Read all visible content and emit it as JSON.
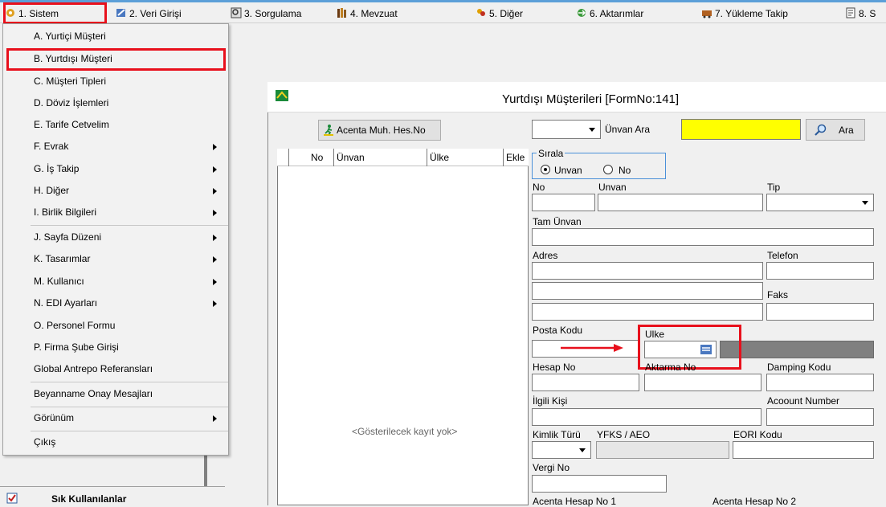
{
  "menubar": {
    "items": [
      {
        "label": "1. Sistem"
      },
      {
        "label": "2. Veri Girişi"
      },
      {
        "label": "3. Sorgulama"
      },
      {
        "label": "4. Mevzuat"
      },
      {
        "label": "5. Diğer"
      },
      {
        "label": "6. Aktarımlar"
      },
      {
        "label": "7. Yükleme Takip"
      },
      {
        "label": "8. S"
      }
    ]
  },
  "dropdown": {
    "items": [
      {
        "label": "A. Yurtiçi Müşteri"
      },
      {
        "label": "B. Yurtdışı Müşteri"
      },
      {
        "label": "C. Müşteri Tipleri"
      },
      {
        "label": "D. Döviz İşlemleri"
      },
      {
        "label": "E. Tarife Cetvelim"
      },
      {
        "label": "F. Evrak"
      },
      {
        "label": "G. İş Takip"
      },
      {
        "label": "H. Diğer"
      },
      {
        "label": "I. Birlik Bilgileri"
      },
      {
        "label": "J. Sayfa Düzeni"
      },
      {
        "label": "K. Tasarımlar"
      },
      {
        "label": "M. Kullanıcı"
      },
      {
        "label": "N. EDI Ayarları"
      },
      {
        "label": "O. Personel Formu"
      },
      {
        "label": "P. Firma Şube Girişi"
      },
      {
        "label": "Global Antrepo Referansları"
      },
      {
        "label": "Beyanname Onay Mesajları"
      },
      {
        "label": "Görünüm"
      },
      {
        "label": "Çıkış"
      }
    ]
  },
  "leftpane": {
    "favorites_label": "Sık Kullanılanlar"
  },
  "form": {
    "title": "Yurtdışı Müşterileri [FormNo:141]",
    "acenta_button": "Acenta Muh. Hes.No",
    "unvan_ara_label": "Ünvan Ara",
    "ara_button": "Ara",
    "grid": {
      "columns": [
        "No",
        "Ünvan",
        "Ülke",
        "Ekle"
      ],
      "empty_text": "<Gösterilecek kayıt yok>"
    },
    "sirala": {
      "group_label": "Sırala",
      "option_unvan": "Unvan",
      "option_no": "No",
      "selected": "Unvan"
    },
    "labels": {
      "no": "No",
      "unvan": "Unvan",
      "tip": "Tip",
      "tam_unvan": "Tam Ünvan",
      "adres": "Adres",
      "telefon": "Telefon",
      "faks": "Faks",
      "posta_kodu": "Posta Kodu",
      "ulke": "Ulke",
      "hesap_no": "Hesap No",
      "aktarma_no": "Aktarma No",
      "damping_kodu": "Damping Kodu",
      "ilgili_kisi": "İlgili Kişi",
      "account_number": "Acoount Number",
      "kimlik_turu": "Kimlik Türü",
      "yfks_aeo": "YFKS / AEO",
      "eori_kodu": "EORI Kodu",
      "vergi_no": "Vergi No",
      "acenta_hesap_no_1": "Acenta Hesap No 1",
      "acenta_hesap_no_2": "Acenta Hesap No 2"
    }
  },
  "colors": {
    "highlight_red": "#e8101c",
    "search_yellow": "#ffff00",
    "menubar_top": "#5c9fd8"
  }
}
